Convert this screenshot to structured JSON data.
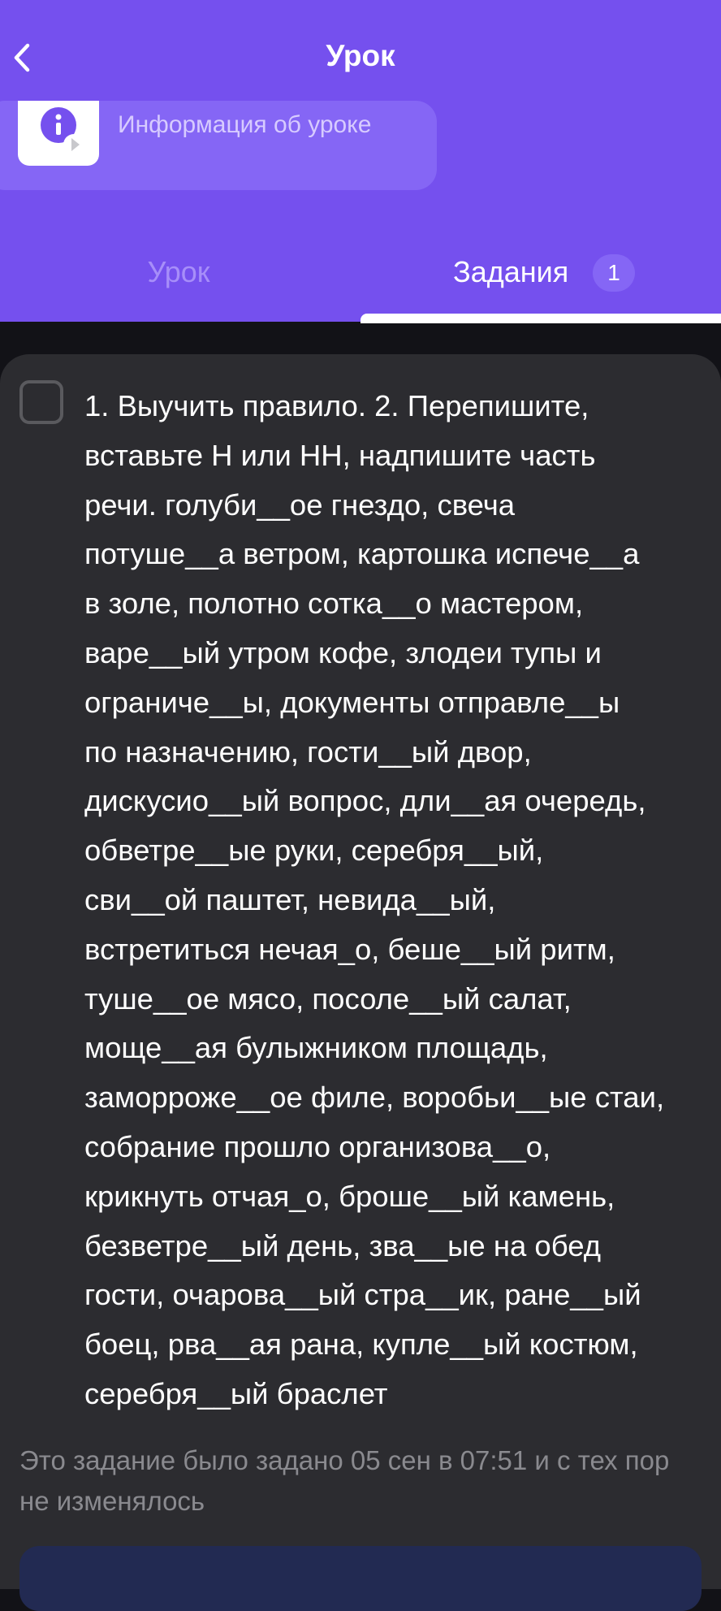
{
  "header": {
    "title": "Урок",
    "info_label": "Информация об уроке",
    "accent_color": "#7550ee"
  },
  "tabs": [
    {
      "label": "Урок",
      "active": false
    },
    {
      "label": "Задания",
      "active": true,
      "badge": "1"
    }
  ],
  "task": {
    "checked": false,
    "text": "1. Выучить правило. 2. Перепишите,\nвставьте Н или НН, надпишите часть\nречи. голуби__ое гнездо, свеча\nпотуше__а ветром, картошка испече__а\nв золе, полотно сотка__о мастером,\nваре__ый утром кофе, злодеи тупы и\nограниче__ы, документы отправле__ы\nпо назначению, гости__ый двор,\nдискусио__ый вопрос, дли__ая очередь,\nобветре__ые руки, серебря__ый,\nсви__ой паштет, невида__ый,\nвстретиться нечая_о, беше__ый ритм,\nтуше__ое мясо, посоле__ый салат,\nмоще__ая булыжником площадь,\nзаморроже__ое филе, воробьи__ые стаи,\nсобрание прошло организова__о,\nкрикнуть отчая_о, броше__ый камень,\nбезветре__ый день, зва__ые на обед\nгости, очарова__ый стра__ик, ране__ый\nбоец, рва__ая рана, купле__ый костюм,\nсеребря__ый браслет",
    "meta": "Это задание было задано 05 сен в 07:51 и с тех пор не изменялось"
  }
}
